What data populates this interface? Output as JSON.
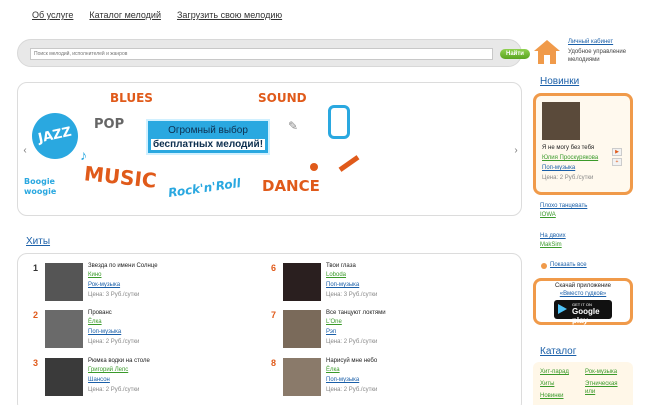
{
  "nav": {
    "items": [
      "Об услуге",
      "Каталог мелодий",
      "Загрузить свою мелодию"
    ]
  },
  "search": {
    "placeholder": "Поиск мелодий, исполнителей и жанров",
    "button": "Найти"
  },
  "banner": {
    "words": [
      "JAZZ",
      "BLUES",
      "POP",
      "SOUND",
      "Boogie woogie",
      "MUSIC",
      "Rock'n'Roll",
      "DANCE"
    ],
    "headline_line1": "Огромный выбор",
    "headline_line2": "бесплатных мелодий!",
    "prev_icon": "chevron-left-icon",
    "next_icon": "chevron-right-icon"
  },
  "hits": {
    "title": "Хиты",
    "items": [
      {
        "num": "1",
        "title": "Звезда по имени Солнце",
        "artist": "Кино",
        "genre": "Рок-музыка",
        "price": "Цена: 3 Руб./сутки"
      },
      {
        "num": "2",
        "title": "Прованс",
        "artist": "Ёлка",
        "genre": "Поп-музыка",
        "price": "Цена: 2 Руб./сутки"
      },
      {
        "num": "3",
        "title": "Рюмка водки на столе",
        "artist": "Григорий Лепс",
        "genre": "Шансон",
        "price": "Цена: 2 Руб./сутки"
      },
      {
        "num": "6",
        "title": "Твои глаза",
        "artist": "Loboda",
        "genre": "Поп-музыка",
        "price": "Цена: 3 Руб./сутки"
      },
      {
        "num": "7",
        "title": "Все танцуют локтями",
        "artist": "L'One",
        "genre": "Рэп",
        "price": "Цена: 2 Руб./сутки"
      },
      {
        "num": "8",
        "title": "Нарисуй мне небо",
        "artist": "Ёлка",
        "genre": "Поп-музыка",
        "price": "Цена: 2 Руб./сутки"
      }
    ]
  },
  "cabinet": {
    "link": "Личный кабинет",
    "desc": "Удобное управление мелодиями",
    "icon": "home-icon"
  },
  "news": {
    "title": "Новинки",
    "featured": {
      "song": "Я не могу без тебя",
      "artist": "Юлия Проскурякова",
      "genre": "Поп-музыка",
      "price": "Цена: 2 Руб./сутки"
    },
    "items": [
      {
        "title": "Плохо танцевать",
        "artist": "IOWA"
      },
      {
        "title": "На двоих",
        "artist": "MakSim"
      }
    ],
    "show_all": "Показать все"
  },
  "app": {
    "line1": "Скачай приложение",
    "line2": "«Вместо гудков»",
    "badge_small": "GET IT ON",
    "badge_big": "Google play"
  },
  "catalog": {
    "title": "Каталог",
    "col1": [
      "Хит-парад",
      "Хиты",
      "Новинки"
    ],
    "col2": [
      "Рок-музыка",
      "Этническая",
      "или"
    ]
  },
  "colors": {
    "accent": "#f09a4a",
    "link": "#1a5fa8",
    "green": "#3a9a2a"
  }
}
